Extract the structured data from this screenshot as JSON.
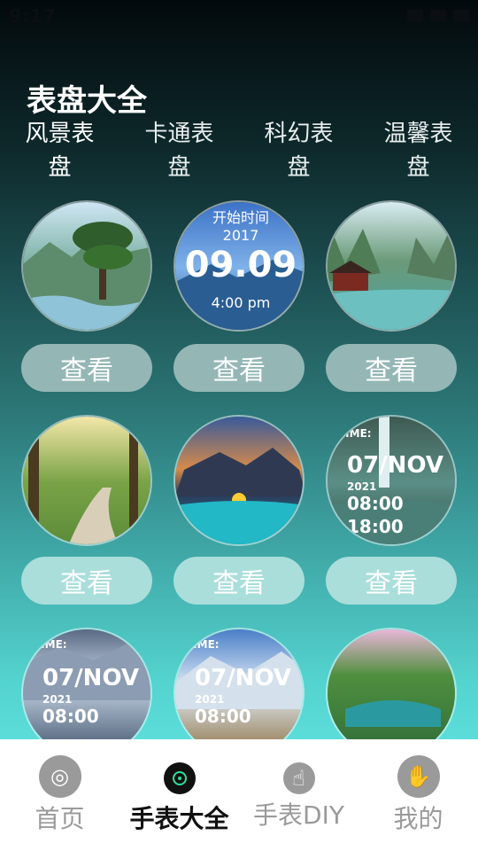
{
  "status": {
    "time": "9:17",
    "icons": [
      "signal-icon",
      "wifi-icon",
      "battery-icon"
    ]
  },
  "page": {
    "title": "表盘大全"
  },
  "categories": [
    {
      "label": "风景表盘"
    },
    {
      "label": "卡通表盘"
    },
    {
      "label": "科幻表盘"
    },
    {
      "label": "温馨表盘"
    }
  ],
  "dials": [
    {
      "style": "mountain-pine",
      "texts": [],
      "button": "查看"
    },
    {
      "style": "digital-lake",
      "texts": [
        "开始时间",
        "2017",
        "09.09",
        "4:00 pm"
      ],
      "button": "查看"
    },
    {
      "style": "pagoda-river",
      "texts": [],
      "button": "查看"
    },
    {
      "style": "forest-path",
      "texts": [],
      "button": "查看"
    },
    {
      "style": "sunset-coast",
      "texts": [],
      "button": "查看"
    },
    {
      "style": "waterfall-date",
      "texts": [
        "TIME:",
        "07/NOV",
        "2021",
        "08:00",
        "18:00"
      ],
      "button": "查看"
    },
    {
      "style": "snow-mountain-date",
      "texts": [
        "TIME:",
        "07/NOV",
        "2021",
        "08:00"
      ],
      "button": ""
    },
    {
      "style": "alpine-date",
      "texts": [
        "TIME:",
        "07/NOV",
        "2021",
        "08:00"
      ],
      "button": ""
    },
    {
      "style": "green-valley",
      "texts": [],
      "button": ""
    }
  ],
  "tabbar": {
    "items": [
      {
        "label": "首页",
        "icon": "home-icon"
      },
      {
        "label": "手表大全",
        "icon": "watch-icon"
      },
      {
        "label": "手表DIY",
        "icon": "touch-icon"
      },
      {
        "label": "我的",
        "icon": "profile-hand-icon"
      }
    ],
    "active_index": 1
  },
  "colors": {
    "button_dark": "#94b7b5",
    "button_light": "#aadedb",
    "tab_active": "#111111",
    "tab_inactive": "#9a9a9a"
  }
}
